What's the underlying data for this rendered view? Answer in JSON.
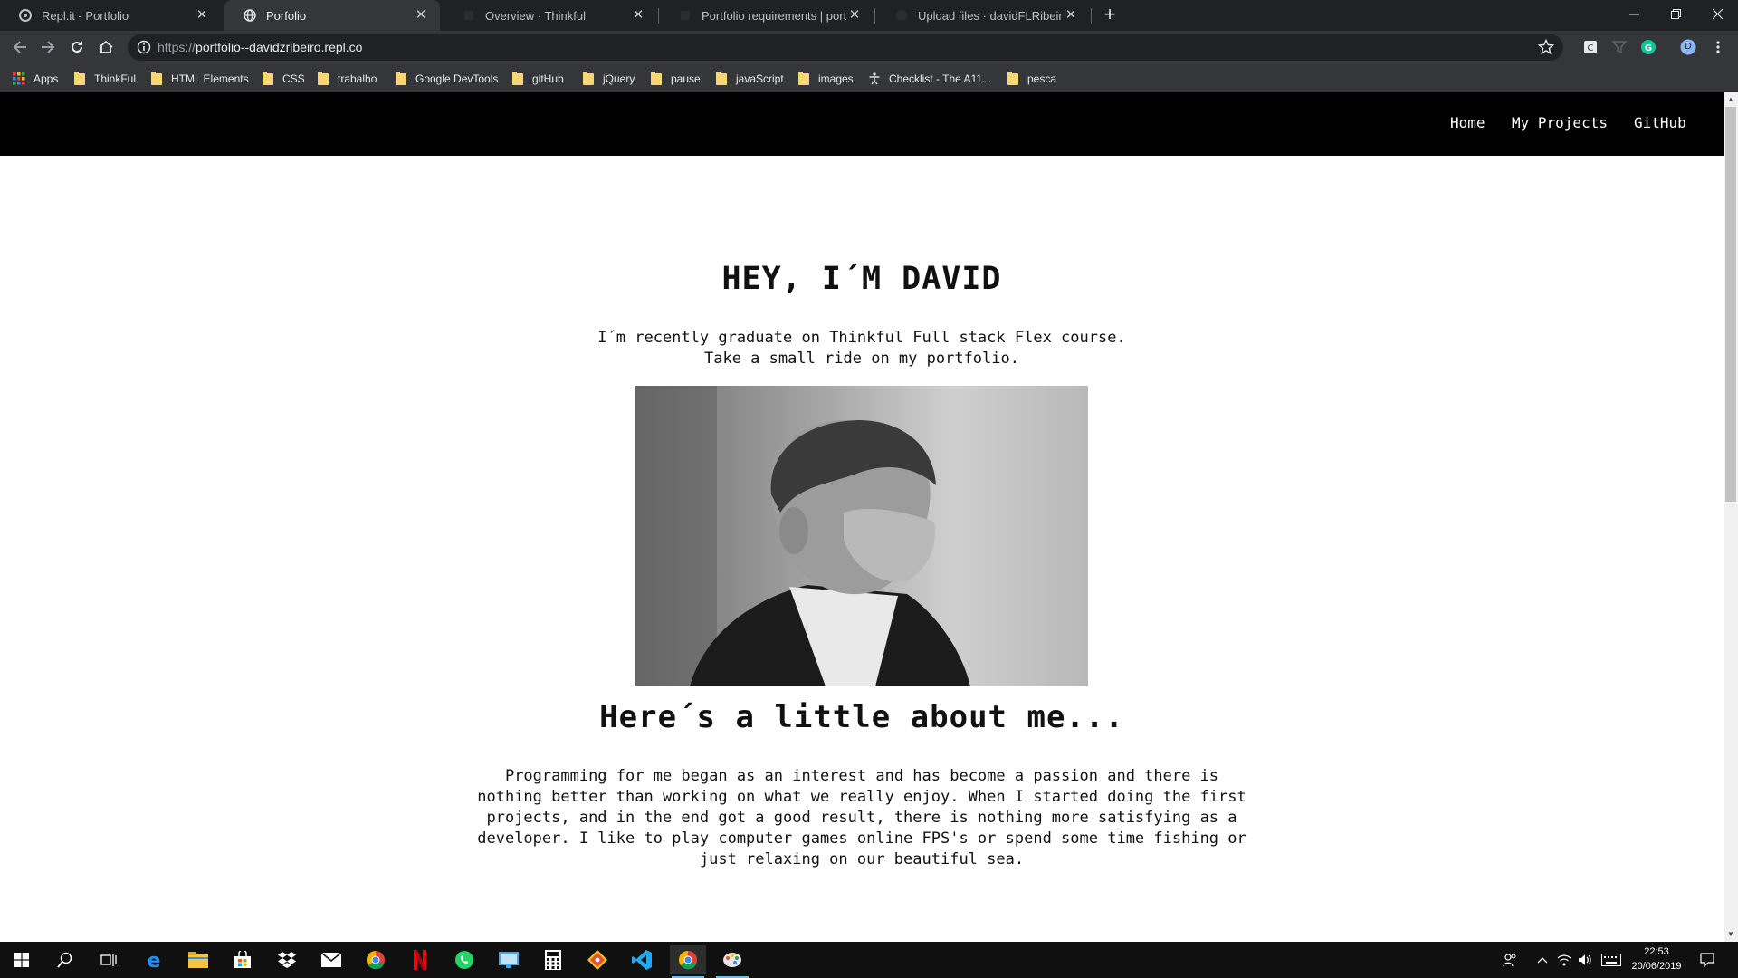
{
  "browser": {
    "tabs": [
      {
        "title": "Repl.it - Portfolio",
        "active": false
      },
      {
        "title": "Porfolio",
        "active": true
      },
      {
        "title": "Overview · Thinkful",
        "active": false
      },
      {
        "title": "Portfolio requirements | portfolio",
        "active": false
      },
      {
        "title": "Upload files · davidFLRibeiro/POR",
        "active": false
      }
    ],
    "url_scheme": "https://",
    "url_host": "portfolio--davidzribeiro.repl.co",
    "profile_initial": "D",
    "bookmarks": [
      "Apps",
      "ThinkFul",
      "HTML Elements",
      "CSS",
      "trabalho",
      "Google DevTools",
      "gitHub",
      "jQuery",
      "pause",
      "javaScript",
      "images",
      "Checklist - The A11...",
      "pesca"
    ]
  },
  "site": {
    "nav": [
      "Home",
      "My Projects",
      "GitHub"
    ],
    "hero_title": "HEY, I´M DAVID",
    "hero_line1": "I´m recently graduate on Thinkful Full stack Flex course.",
    "hero_line2": "Take a small ride on my portfolio.",
    "about_title": "Here´s a little about me...",
    "about_text": "Programming for me began as an interest and has become a passion and there is nothing better than working on what we really enjoy. When I started doing the first projects, and in the end got a good result, there is nothing more satisfying as a developer. I like to play computer games online FPS's or spend some time fishing or just relaxing on our beautiful sea."
  },
  "taskbar": {
    "time": "22:53",
    "date": "20/06/2019"
  },
  "colors": {
    "tabstrip": "#202124",
    "toolbar": "#35363a",
    "site_nav": "#000000",
    "taskbar": "#101010",
    "folder": "#f7d774"
  }
}
